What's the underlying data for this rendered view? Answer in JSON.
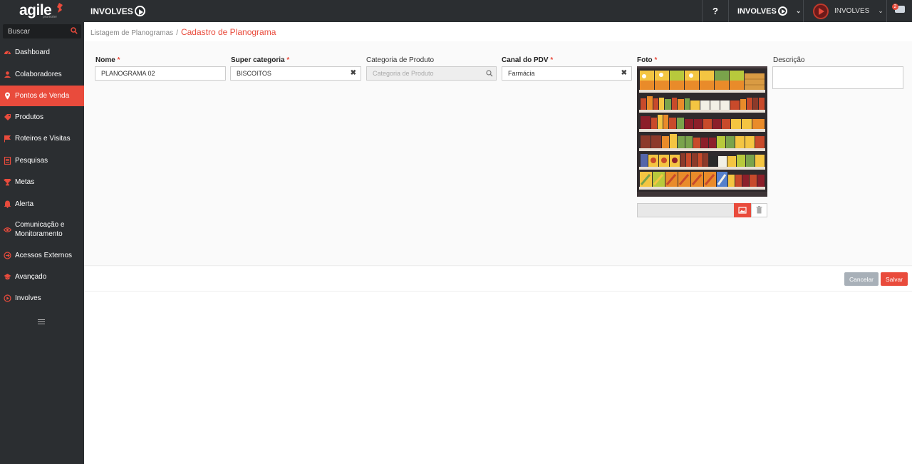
{
  "app": {
    "logo_text": "agile",
    "logo_subtext": "promoter",
    "brand": "INVOLVES",
    "help_label": "?",
    "brand_switch_label": "INVOLVES",
    "user_name": "INVOLVES",
    "notification_count": "2",
    "accent_color": "#e94b3c",
    "sidebar_bg": "#2b2e31"
  },
  "sidebar": {
    "search_placeholder": "Buscar",
    "items": [
      {
        "label": "Dashboard",
        "icon": "dashboard-icon"
      },
      {
        "label": "Colaboradores",
        "icon": "users-icon"
      },
      {
        "label": "Pontos de Venda",
        "icon": "map-pin-icon",
        "active": true
      },
      {
        "label": "Produtos",
        "icon": "tag-icon"
      },
      {
        "label": "Roteiros e Visitas",
        "icon": "flag-icon"
      },
      {
        "label": "Pesquisas",
        "icon": "clipboard-icon"
      },
      {
        "label": "Metas",
        "icon": "trophy-icon"
      },
      {
        "label": "Alerta",
        "icon": "bell-icon"
      },
      {
        "label": "Comunicação e Monitoramento",
        "icon": "eye-icon"
      },
      {
        "label": "Acessos Externos",
        "icon": "external-access-icon"
      },
      {
        "label": "Avançado",
        "icon": "advanced-icon"
      },
      {
        "label": "Involves",
        "icon": "involves-play-icon"
      }
    ]
  },
  "breadcrumb": {
    "parent": "Listagem de Planogramas",
    "separator": "/",
    "current": "Cadastro de Planograma"
  },
  "form": {
    "nome": {
      "label": "Nome",
      "value": "PLANOGRAMA 02"
    },
    "super_categoria": {
      "label": "Super categoria",
      "value": "BISCOITOS"
    },
    "categoria_produto": {
      "label": "Categoria de Produto",
      "placeholder": "Categoria de Produto"
    },
    "canal_pdv": {
      "label": "Canal do PDV",
      "value": "Farmácia"
    },
    "foto": {
      "label": "Foto"
    },
    "descricao": {
      "label": "Descrição",
      "value": ""
    },
    "required_mark": "*"
  },
  "actions": {
    "cancel_label": "Cancelar",
    "save_label": "Salvar"
  }
}
